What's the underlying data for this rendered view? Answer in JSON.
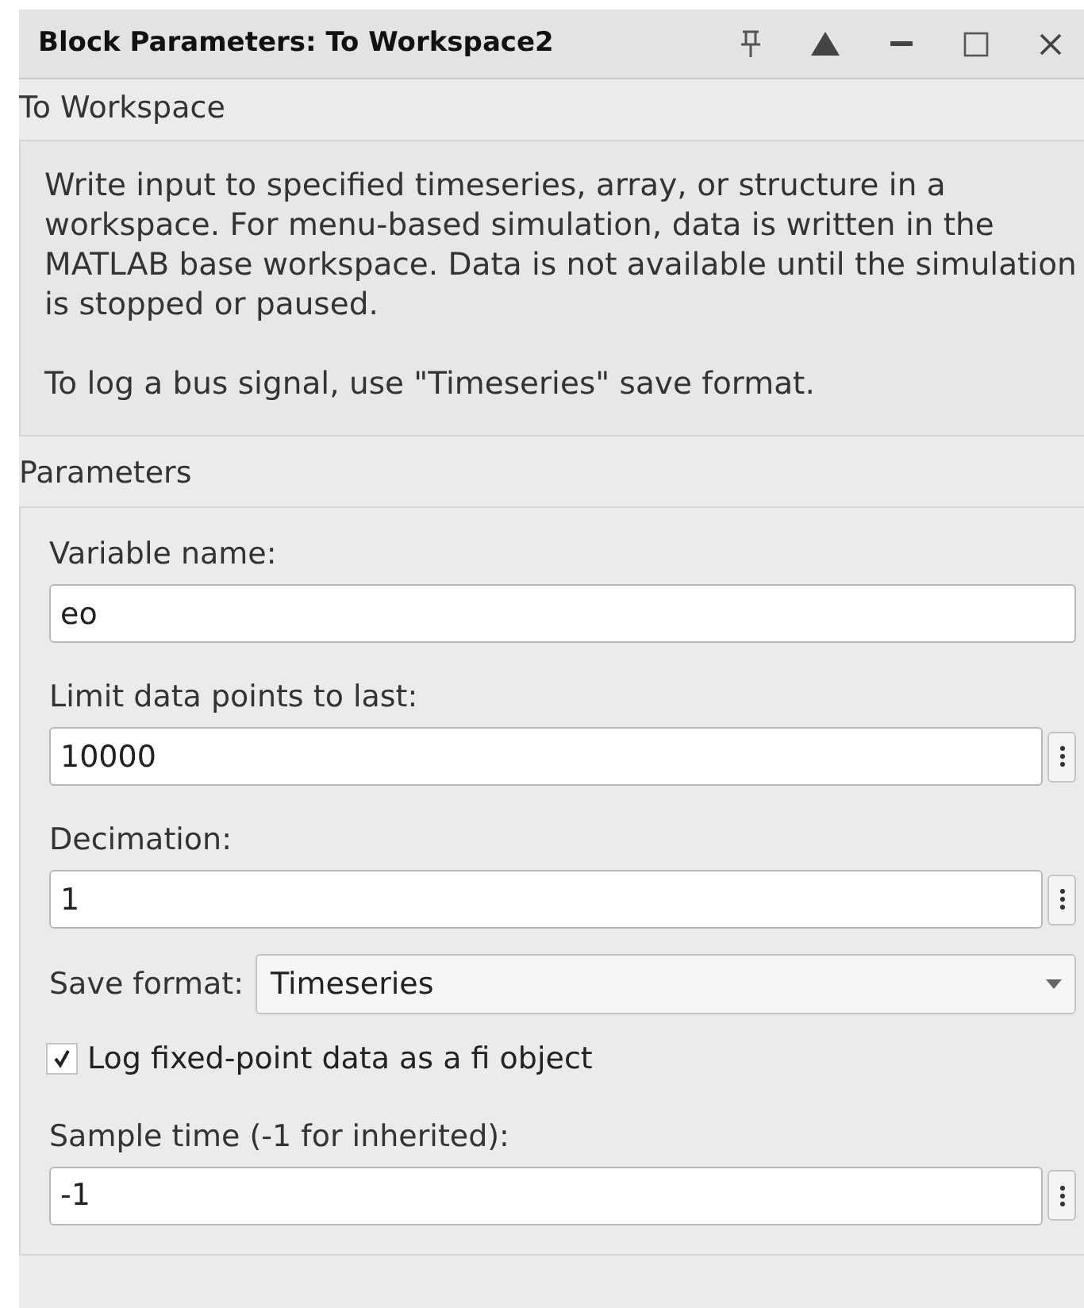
{
  "window": {
    "title": "Block Parameters: To Workspace2"
  },
  "block_name": "To Workspace",
  "description": [
    "Write input to specified timeseries, array, or structure in a workspace. For menu-based simulation, data is written in the MATLAB base workspace. Data is not available until the simulation is stopped or paused.",
    "To log a bus signal, use \"Timeseries\" save format."
  ],
  "parameters_title": "Parameters",
  "parameters": [
    {
      "kind": "text",
      "label": "Variable name:",
      "value": "eo",
      "more_button": false
    },
    {
      "kind": "text",
      "label": "Limit data points to last:",
      "value": "10000",
      "more_button": true
    },
    {
      "kind": "text",
      "label": "Decimation:",
      "value": "1",
      "more_button": true
    },
    {
      "kind": "dropdown",
      "label": "Save format:",
      "value": "Timeseries"
    },
    {
      "kind": "checkbox",
      "label": "Log fixed-point data as a fi object",
      "checked": true
    },
    {
      "kind": "text",
      "label": "Sample time (-1 for inherited):",
      "value": "-1",
      "more_button": true
    }
  ]
}
